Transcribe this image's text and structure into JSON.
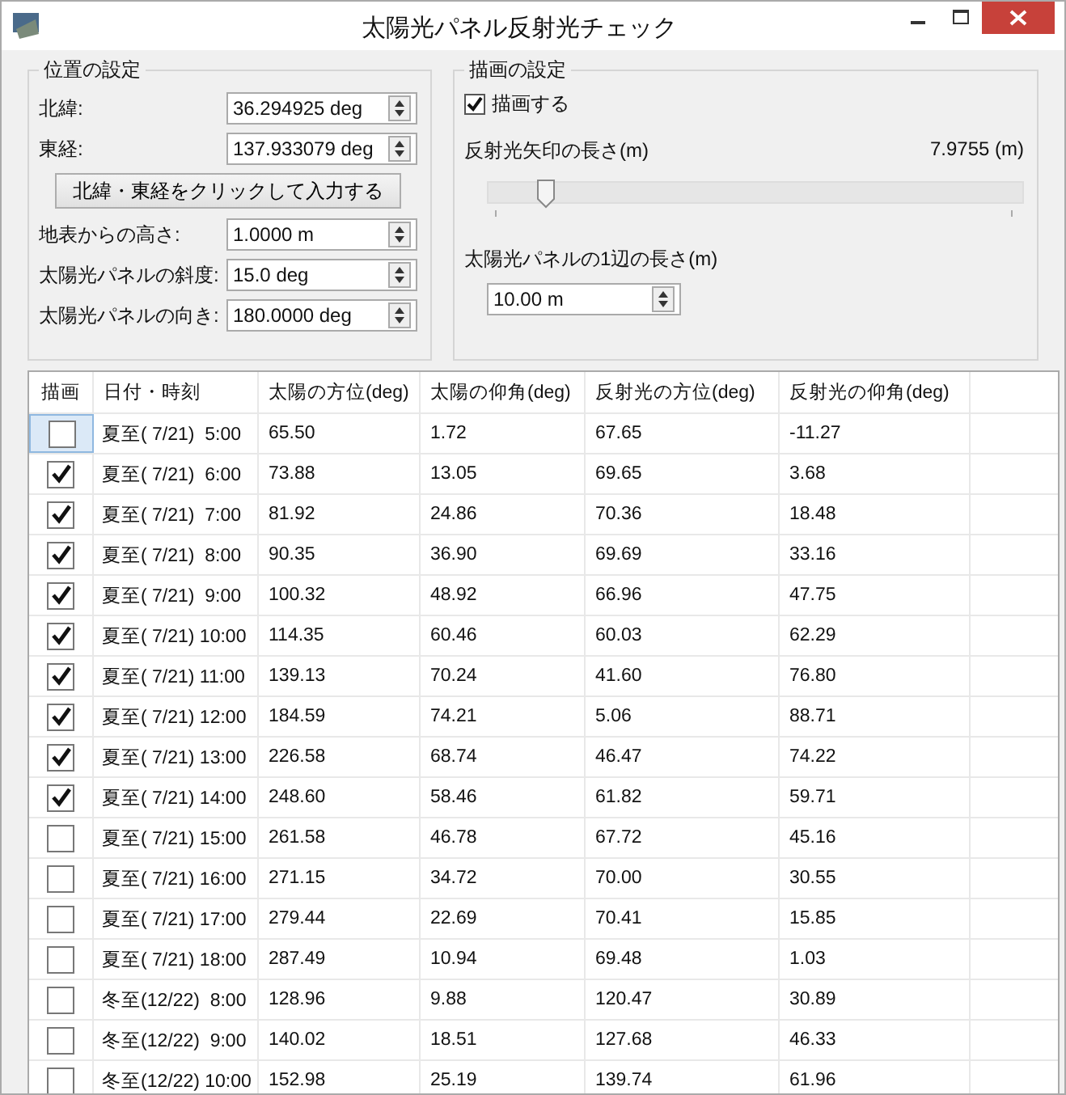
{
  "window": {
    "title": "太陽光パネル反射光チェック"
  },
  "location": {
    "title": "位置の設定",
    "fields": [
      {
        "label": "北緯:",
        "value": "36.294925 deg"
      },
      {
        "label": "東経:",
        "value": "137.933079 deg"
      }
    ],
    "button": "北緯・東経をクリックして入力する",
    "fields2": [
      {
        "label": "地表からの高さ:",
        "value": "1.0000 m"
      },
      {
        "label": "太陽光パネルの斜度:",
        "value": "15.0 deg"
      },
      {
        "label": "太陽光パネルの向き:",
        "value": "180.0000 deg"
      }
    ]
  },
  "drawing": {
    "title": "描画の設定",
    "draw_check": {
      "label": "描画する",
      "checked": true
    },
    "arrow_label": "反射光矢印の長さ(m)",
    "arrow_value": "7.9755 (m)",
    "slider": {
      "level": 0.09
    },
    "panel_label": "太陽光パネルの1辺の長さ(m)",
    "panel_value": "10.00 m"
  },
  "table": {
    "check_column": "描画",
    "columns": [
      "日付・時刻",
      "太陽の方位(deg)",
      "太陽の仰角(deg)",
      "反射光の方位(deg)",
      "反射光の仰角(deg)"
    ],
    "rows": [
      {
        "selected": true,
        "checked": false,
        "cells": [
          "夏至( 7/21)  5:00",
          "65.50",
          "1.72",
          "67.65",
          "-11.27"
        ]
      },
      {
        "selected": false,
        "checked": true,
        "cells": [
          "夏至( 7/21)  6:00",
          "73.88",
          "13.05",
          "69.65",
          "3.68"
        ]
      },
      {
        "selected": false,
        "checked": true,
        "cells": [
          "夏至( 7/21)  7:00",
          "81.92",
          "24.86",
          "70.36",
          "18.48"
        ]
      },
      {
        "selected": false,
        "checked": true,
        "cells": [
          "夏至( 7/21)  8:00",
          "90.35",
          "36.90",
          "69.69",
          "33.16"
        ]
      },
      {
        "selected": false,
        "checked": true,
        "cells": [
          "夏至( 7/21)  9:00",
          "100.32",
          "48.92",
          "66.96",
          "47.75"
        ]
      },
      {
        "selected": false,
        "checked": true,
        "cells": [
          "夏至( 7/21) 10:00",
          "114.35",
          "60.46",
          "60.03",
          "62.29"
        ]
      },
      {
        "selected": false,
        "checked": true,
        "cells": [
          "夏至( 7/21) 11:00",
          "139.13",
          "70.24",
          "41.60",
          "76.80"
        ]
      },
      {
        "selected": false,
        "checked": true,
        "cells": [
          "夏至( 7/21) 12:00",
          "184.59",
          "74.21",
          "5.06",
          "88.71"
        ]
      },
      {
        "selected": false,
        "checked": true,
        "cells": [
          "夏至( 7/21) 13:00",
          "226.58",
          "68.74",
          "46.47",
          "74.22"
        ]
      },
      {
        "selected": false,
        "checked": true,
        "cells": [
          "夏至( 7/21) 14:00",
          "248.60",
          "58.46",
          "61.82",
          "59.71"
        ]
      },
      {
        "selected": false,
        "checked": false,
        "cells": [
          "夏至( 7/21) 15:00",
          "261.58",
          "46.78",
          "67.72",
          "45.16"
        ]
      },
      {
        "selected": false,
        "checked": false,
        "cells": [
          "夏至( 7/21) 16:00",
          "271.15",
          "34.72",
          "70.00",
          "30.55"
        ]
      },
      {
        "selected": false,
        "checked": false,
        "cells": [
          "夏至( 7/21) 17:00",
          "279.44",
          "22.69",
          "70.41",
          "15.85"
        ]
      },
      {
        "selected": false,
        "checked": false,
        "cells": [
          "夏至( 7/21) 18:00",
          "287.49",
          "10.94",
          "69.48",
          "1.03"
        ]
      },
      {
        "selected": false,
        "checked": false,
        "cells": [
          "冬至(12/22)  8:00",
          "128.96",
          "9.88",
          "120.47",
          "30.89"
        ]
      },
      {
        "selected": false,
        "checked": false,
        "cells": [
          "冬至(12/22)  9:00",
          "140.02",
          "18.51",
          "127.68",
          "46.33"
        ]
      },
      {
        "selected": false,
        "checked": false,
        "cells": [
          "冬至(12/22) 10:00",
          "152.98",
          "25.19",
          "139.74",
          "61.96"
        ]
      }
    ]
  }
}
